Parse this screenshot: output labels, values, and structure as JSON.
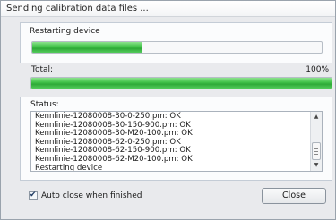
{
  "window": {
    "title": "Sending calibration data files ..."
  },
  "current": {
    "label": "Restarting device",
    "progress": 0.38
  },
  "total": {
    "label": "Total:",
    "percent_text": "100%",
    "progress": 1.0
  },
  "status": {
    "label": "Status:",
    "lines": [
      "Kennlinie-12080008-30-0-250.pm: OK",
      "Kennlinie-12080008-30-150-900.pm: OK",
      "Kennlinie-12080008-30-M20-100.pm: OK",
      "Kennlinie-12080008-62-0-250.pm: OK",
      "Kennlinie-12080008-62-150-900.pm: OK",
      "Kennlinie-12080008-62-M20-100.pm: OK",
      "Restarting device"
    ]
  },
  "options": {
    "auto_close_label": "Auto close when finished",
    "auto_close_checked": true
  },
  "buttons": {
    "close_label": "Close"
  }
}
